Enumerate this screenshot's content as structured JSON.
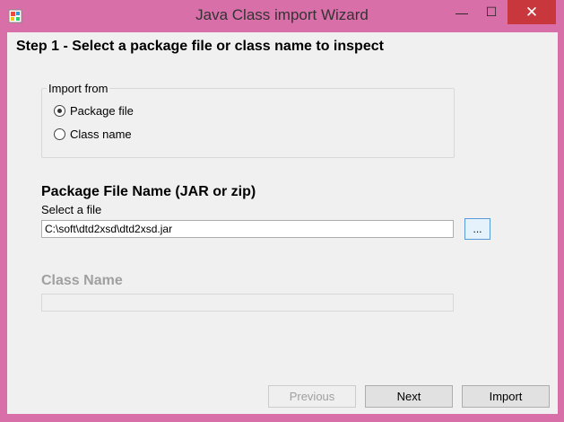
{
  "window": {
    "title": "Java Class import Wizard",
    "minimize_glyph": "—",
    "maximize_glyph": "☐",
    "close_glyph": "✕"
  },
  "step_heading": "Step 1 - Select a package file or class name to inspect",
  "import_from": {
    "legend": "Import from",
    "options": [
      {
        "label": "Package file",
        "checked": true
      },
      {
        "label": "Class name",
        "checked": false
      }
    ]
  },
  "package_section": {
    "title": "Package File Name (JAR or zip)",
    "select_label": "Select a file",
    "file_path": "C:\\soft\\dtd2xsd\\dtd2xsd.jar",
    "browse_label": "..."
  },
  "class_section": {
    "title": "Class Name",
    "value": ""
  },
  "buttons": {
    "previous": "Previous",
    "next": "Next",
    "import": "Import"
  }
}
